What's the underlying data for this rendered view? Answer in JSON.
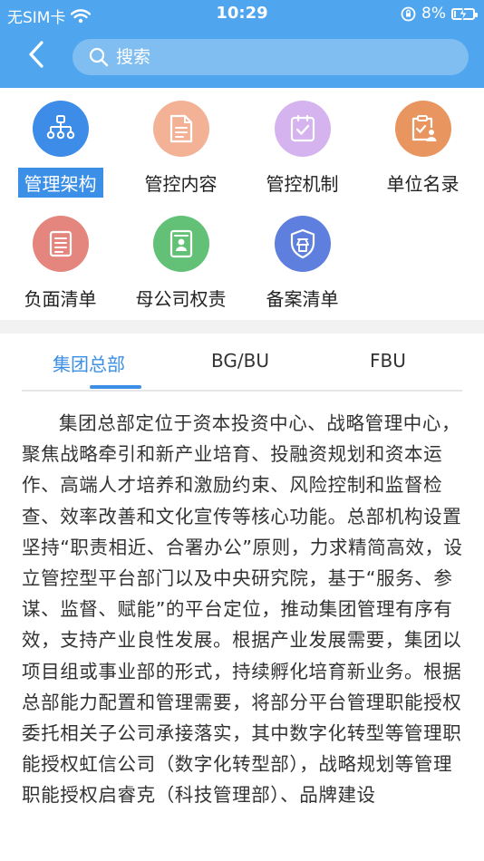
{
  "status_bar": {
    "carrier": "无SIM卡",
    "time": "10:29",
    "battery_percent": "8%",
    "battery_level": 0.08
  },
  "search": {
    "placeholder": "搜索"
  },
  "grid": {
    "items": [
      {
        "label": "管理架构",
        "icon": "org-chart-icon",
        "color": "#3d8de8"
      },
      {
        "label": "管控内容",
        "icon": "document-icon",
        "color": "#f3b295"
      },
      {
        "label": "管控机制",
        "icon": "checklist-icon",
        "color": "#d5b3ee"
      },
      {
        "label": "单位名录",
        "icon": "clipboard-user-icon",
        "color": "#e9955f"
      },
      {
        "label": "负面清单",
        "icon": "list-icon",
        "color": "#e4867e"
      },
      {
        "label": "母公司权责",
        "icon": "id-card-icon",
        "color": "#63c177"
      },
      {
        "label": "备案清单",
        "icon": "badge-icon",
        "color": "#5f7fde"
      }
    ]
  },
  "tabs": [
    {
      "label": "集团总部"
    },
    {
      "label": "BG/BU"
    },
    {
      "label": "FBU"
    }
  ],
  "article": {
    "text": "集团总部定位于资本投资中心、战略管理中心，聚焦战略牵引和新产业培育、投融资规划和资本运作、高端人才培养和激励约束、风险控制和监督检查、效率改善和文化宣传等核心功能。总部机构设置坚持“职责相近、合署办公”原则，力求精简高效，设立管控型平台部门以及中央研究院，基于“服务、参谋、监督、赋能”的平台定位，推动集团管理有序有效，支持产业良性发展。根据产业发展需要，集团以项目组或事业部的形式，持续孵化培育新业务。根据总部能力配置和管理需要，将部分平台管理职能授权委托相关子公司承接落实，其中数字化转型等管理职能授权虹信公司（数字化转型部），战略规划等管理职能授权启睿克（科技管理部）、品牌建设"
  }
}
